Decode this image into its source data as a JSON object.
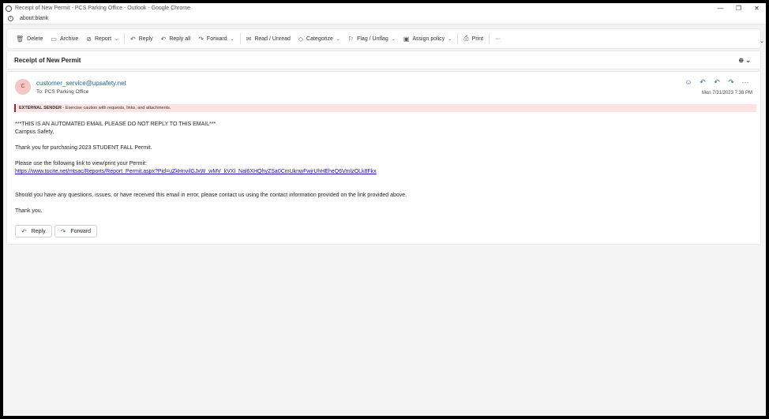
{
  "window": {
    "title": "Receipt of New Permit - PCS Parking Office - Outlook - Google Chrome",
    "minimize": "—",
    "restore": "❐",
    "close": "✕"
  },
  "address": {
    "url": "about:blank",
    "info_icon": "ⓘ"
  },
  "toolbar": {
    "items": [
      {
        "label": "Delete",
        "icon": "🗑"
      },
      {
        "label": "Archive",
        "icon": "▭"
      },
      {
        "label": "Report",
        "icon": "⊘",
        "caret": "⌄"
      },
      {
        "label": "Reply",
        "icon": "↶"
      },
      {
        "label": "Reply all",
        "icon": "↶"
      },
      {
        "label": "Forward",
        "icon": "↷",
        "caret": "⌄"
      },
      {
        "label": "Read / Unread",
        "icon": "✉"
      },
      {
        "label": "Categorize",
        "icon": "◇",
        "caret": "⌄"
      },
      {
        "label": "Flag / Unflag",
        "icon": "⚐",
        "caret": "⌄"
      },
      {
        "label": "Assign policy",
        "icon": "▣",
        "caret": "⌄"
      },
      {
        "label": "Print",
        "icon": "⎙"
      }
    ],
    "more": "···",
    "collapse": "⌄"
  },
  "subject": {
    "text": "Receipt of New Permit",
    "zoom": "⊕ ⌄"
  },
  "message": {
    "avatar_initial": "C",
    "sender": "customer_service@upsafety.net",
    "to": "To:  PCS Parking Office",
    "date": "Mon 7/31/2023 7:38 PM",
    "actions": {
      "emoji": "☺",
      "reply": "↶",
      "reply_all": "↶",
      "forward": "↷",
      "more": "···"
    },
    "banner_bold": "EXTERNAL SENDER",
    "banner_text": " - Exercise caution with requests, links, and attachments.",
    "body": {
      "line1": "***THIS IS AN AUTOMATED EMAIL PLEASE DO NOT REPLY TO THIS EMAIL***",
      "line2": "Campus Safety,",
      "line3": "Thank you for purchasing 2023 STUDENT FALL Permit.",
      "line4": "Please use the following link to view/print your Permit:",
      "link": "https://www.tocite.net/mtsac/Reports/Report_Permit.aspx?Pid=uZkHnvilGJxW_wMV_kVXl_Nal6XHQhyZSa0CmUknwFwjrUhHEheQ6VmlzOLk8Fkx",
      "line5": "Should you have any questions, issues, or have received this email in error, please contact us using the contact information provided on the link provided above.",
      "line6": "Thank you."
    },
    "reply_button": {
      "label": "Reply",
      "icon": "↶"
    },
    "forward_button": {
      "label": "Forward",
      "icon": "↷"
    }
  }
}
